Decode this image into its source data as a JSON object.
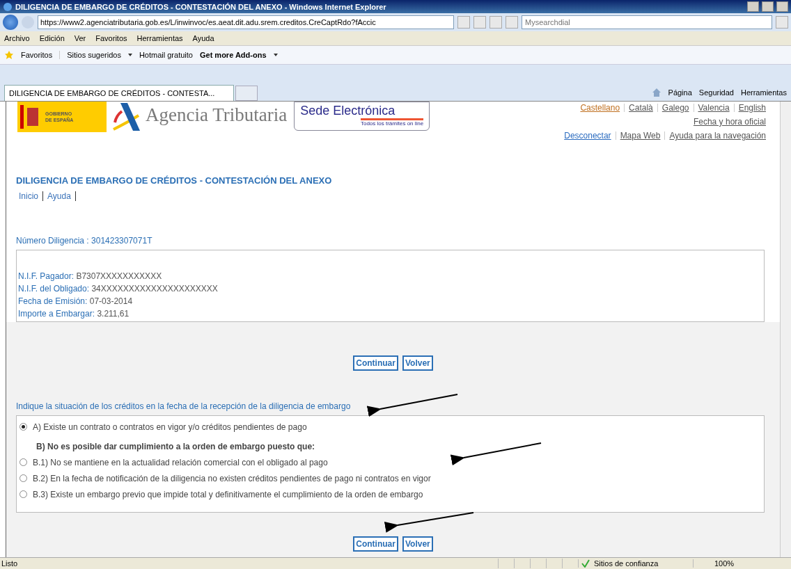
{
  "window": {
    "title": "DILIGENCIA DE EMBARGO DE CRÉDITOS - CONTESTACIÓN DEL ANEXO - Windows Internet Explorer"
  },
  "address_bar": {
    "url": "https://www2.agenciatributaria.gob.es/L/inwinvoc/es.aeat.dit.adu.srem.creditos.CreCaptRdo?fAccic",
    "search_placeholder": "Mysearchdial"
  },
  "menu": [
    "Archivo",
    "Edición",
    "Ver",
    "Favoritos",
    "Herramientas",
    "Ayuda"
  ],
  "favorites_bar": {
    "label": "Favoritos",
    "items": [
      {
        "label": "Sitios sugeridos",
        "dropdown": true,
        "emphasis": false
      },
      {
        "label": "Hotmail gratuito",
        "dropdown": false,
        "emphasis": false
      },
      {
        "label": "Get more Add-ons",
        "dropdown": true,
        "emphasis": true
      }
    ]
  },
  "tab": {
    "title": "DILIGENCIA DE EMBARGO DE CRÉDITOS - CONTESTA..."
  },
  "command_bar": [
    "Página",
    "Seguridad",
    "Herramientas"
  ],
  "header": {
    "logo_lines": [
      "GOBIERNO",
      "DE ESPAÑA"
    ],
    "agency": "Agencia Tributaria",
    "sede_title": "Sede Electrónica",
    "sede_subtitle": "Todos los trámites on line",
    "languages": [
      "Castellano",
      "Català",
      "Galego",
      "Valencia",
      "English"
    ],
    "official_time": "Fecha y hora oficial",
    "links": [
      "Desconectar",
      "Mapa Web",
      "Ayuda para la navegación"
    ]
  },
  "page": {
    "title": "DILIGENCIA DE EMBARGO DE CRÉDITOS - CONTESTACIÓN DEL ANEXO",
    "nav": [
      "Inicio",
      "Ayuda"
    ],
    "diligencia": "Número Diligencia : 301423307071T",
    "fields": [
      {
        "label": "N.I.F. Pagador:",
        "value": "B7307XXXXXXXXXXX"
      },
      {
        "label": "N.I.F. del Obligado:",
        "value": "34XXXXXXXXXXXXXXXXXXXXX"
      },
      {
        "label": "Fecha de Emisión:",
        "value": "07-03-2014"
      },
      {
        "label": "Importe a Embargar:",
        "value": "3.211,61"
      }
    ],
    "buttons": [
      "Continuar",
      "Volver"
    ],
    "question": "Indique la situación de los créditos en la fecha de la recepción de la diligencia de embargo",
    "options": [
      {
        "kind": "radio",
        "label": "A) Existe un contrato o contratos en vigor y/o créditos pendientes de pago",
        "selected": true
      },
      {
        "kind": "heading",
        "label": "B) No es posible dar cumplimiento a la orden de embargo puesto que:"
      },
      {
        "kind": "radio",
        "label": "B.1) No se mantiene en la actualidad relación comercial con el obligado al pago",
        "selected": false
      },
      {
        "kind": "radio",
        "label": "B.2) En la fecha de notificación de la diligencia no existen créditos pendientes de pago ni contratos en vigor",
        "selected": false
      },
      {
        "kind": "radio",
        "label": "B.3) Existe un embargo previo que impide total y definitivamente el cumplimiento de la orden de embargo",
        "selected": false
      }
    ],
    "bottom_buttons": [
      "Continuar",
      "Volver"
    ]
  },
  "status_bar": {
    "text": "Listo",
    "zone": "Sitios de confianza",
    "zoom": "100%"
  }
}
